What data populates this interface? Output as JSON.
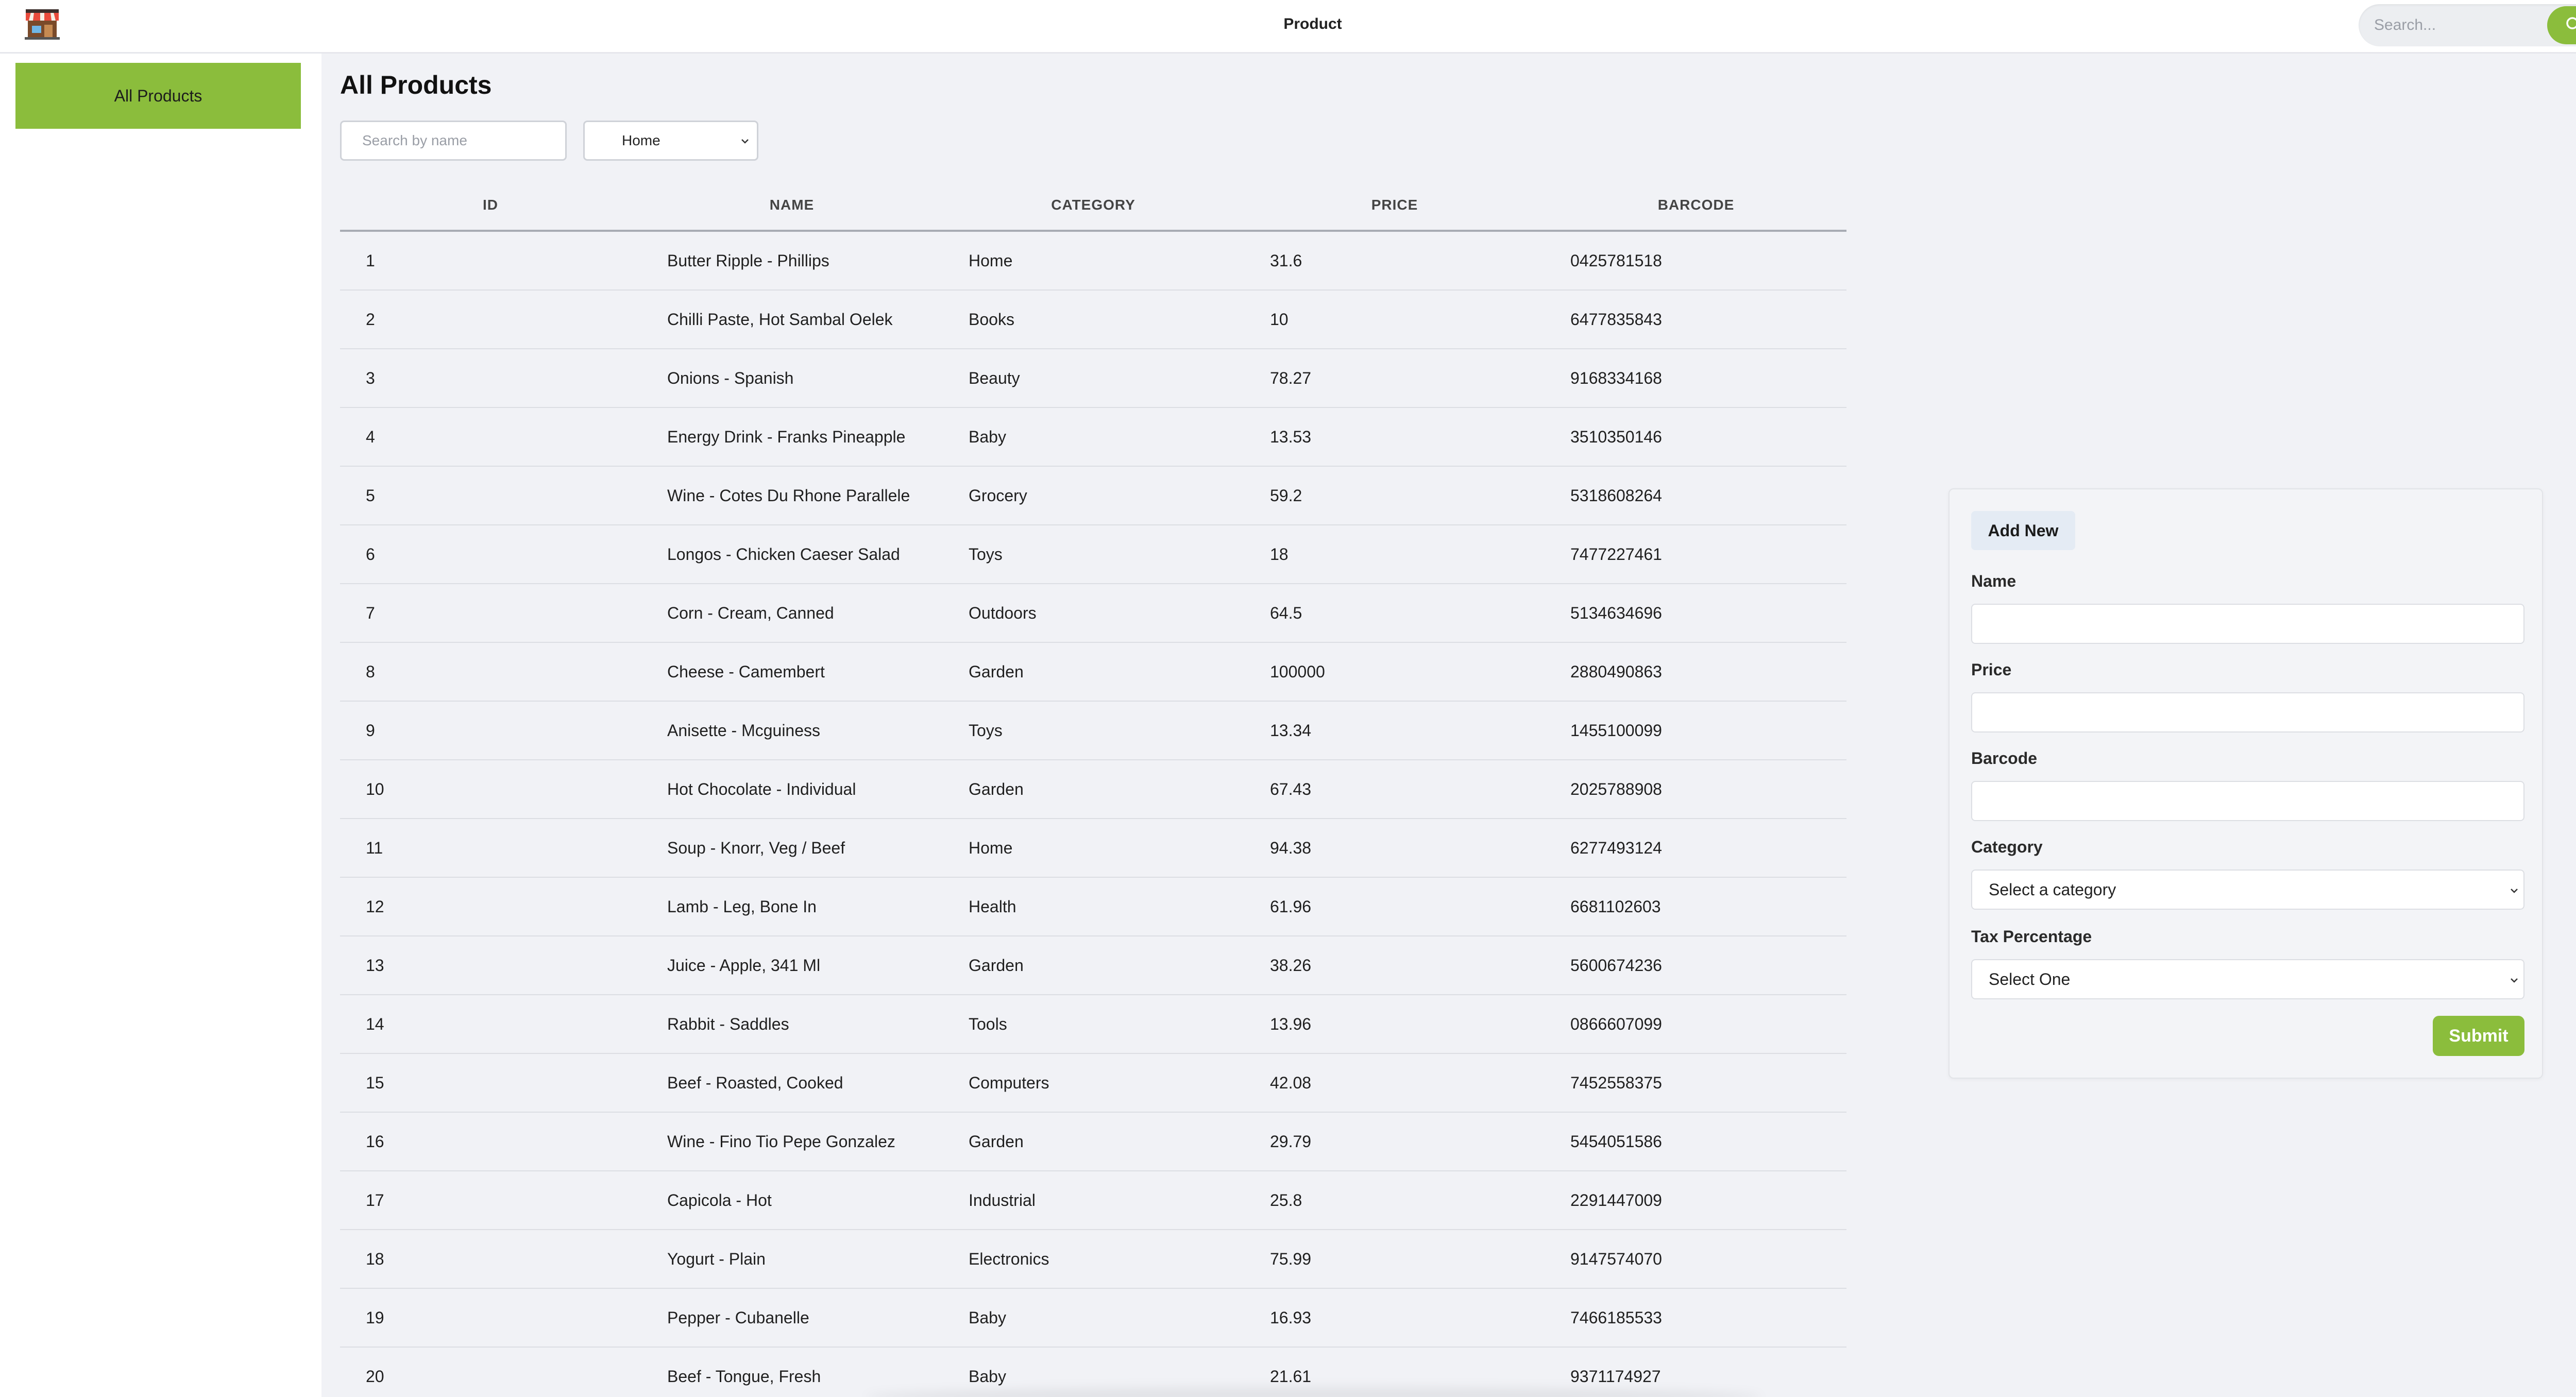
{
  "header": {
    "title": "Product",
    "logo_icon": "store-icon",
    "search": {
      "placeholder": "Search...",
      "value": ""
    },
    "search_button_icon": "search-icon"
  },
  "sidebar": {
    "items": [
      {
        "label": "All Products",
        "active": true
      }
    ]
  },
  "main": {
    "title": "All Products",
    "filter": {
      "name_placeholder": "Search by name",
      "category_selected": "Home"
    },
    "table": {
      "headers": [
        "ID",
        "NAME",
        "CATEGORY",
        "PRICE",
        "BARCODE"
      ],
      "rows": [
        [
          "1",
          "Butter Ripple - Phillips",
          "Home",
          "31.6",
          "0425781518"
        ],
        [
          "2",
          "Chilli Paste, Hot Sambal Oelek",
          "Books",
          "10",
          "6477835843"
        ],
        [
          "3",
          "Onions - Spanish",
          "Beauty",
          "78.27",
          "9168334168"
        ],
        [
          "4",
          "Energy Drink - Franks Pineapple",
          "Baby",
          "13.53",
          "3510350146"
        ],
        [
          "5",
          "Wine - Cotes Du Rhone Parallele",
          "Grocery",
          "59.2",
          "5318608264"
        ],
        [
          "6",
          "Longos - Chicken Caeser Salad",
          "Toys",
          "18",
          "7477227461"
        ],
        [
          "7",
          "Corn - Cream, Canned",
          "Outdoors",
          "64.5",
          "5134634696"
        ],
        [
          "8",
          "Cheese - Camembert",
          "Garden",
          "100000",
          "2880490863"
        ],
        [
          "9",
          "Anisette - Mcguiness",
          "Toys",
          "13.34",
          "1455100099"
        ],
        [
          "10",
          "Hot Chocolate - Individual",
          "Garden",
          "67.43",
          "2025788908"
        ],
        [
          "11",
          "Soup - Knorr, Veg / Beef",
          "Home",
          "94.38",
          "6277493124"
        ],
        [
          "12",
          "Lamb - Leg, Bone In",
          "Health",
          "61.96",
          "6681102603"
        ],
        [
          "13",
          "Juice - Apple, 341 Ml",
          "Garden",
          "38.26",
          "5600674236"
        ],
        [
          "14",
          "Rabbit - Saddles",
          "Tools",
          "13.96",
          "0866607099"
        ],
        [
          "15",
          "Beef - Roasted, Cooked",
          "Computers",
          "42.08",
          "7452558375"
        ],
        [
          "16",
          "Wine - Fino Tio Pepe Gonzalez",
          "Garden",
          "29.79",
          "5454051586"
        ],
        [
          "17",
          "Capicola - Hot",
          "Industrial",
          "25.8",
          "2291447009"
        ],
        [
          "18",
          "Yogurt - Plain",
          "Electronics",
          "75.99",
          "9147574070"
        ],
        [
          "19",
          "Pepper - Cubanelle",
          "Baby",
          "16.93",
          "7466185533"
        ],
        [
          "20",
          "Beef - Tongue, Fresh",
          "Baby",
          "21.61",
          "9371174927"
        ]
      ]
    }
  },
  "add_form": {
    "tab_label": "Add New",
    "name_label": "Name",
    "name_value": "",
    "price_label": "Price",
    "price_value": "",
    "barcode_label": "Barcode",
    "barcode_value": "",
    "category_label": "Category",
    "category_selected": "Select a category",
    "tax_label": "Tax Percentage",
    "tax_selected": "Select One",
    "submit_label": "Submit"
  },
  "colors": {
    "accent": "#8bbd3c",
    "background": "#f1f2f6",
    "panel_tab": "#e4ebf4"
  }
}
